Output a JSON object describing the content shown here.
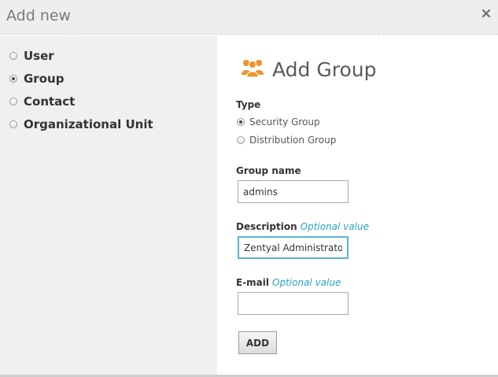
{
  "dialog": {
    "title": "Add new"
  },
  "sidebar": {
    "items": [
      {
        "label": "User",
        "selected": false
      },
      {
        "label": "Group",
        "selected": true
      },
      {
        "label": "Contact",
        "selected": false
      },
      {
        "label": "Organizational Unit",
        "selected": false
      }
    ]
  },
  "form": {
    "heading": "Add Group",
    "type_label": "Type",
    "type_options": [
      {
        "label": "Security Group",
        "selected": true
      },
      {
        "label": "Distribution Group",
        "selected": false
      }
    ],
    "group_name_label": "Group name",
    "group_name_value": "admins",
    "description_label": "Description",
    "description_optional": "Optional value",
    "description_value": "Zentyal Administrators",
    "email_label": "E-mail",
    "email_optional": "Optional value",
    "email_value": "",
    "add_button_label": "ADD"
  },
  "colors": {
    "accent_optional": "#2aa3c9",
    "group_icon": "#f0922a",
    "focus_border": "#5ab4d8"
  },
  "icons": {
    "close": "close-icon",
    "group": "group-icon"
  }
}
